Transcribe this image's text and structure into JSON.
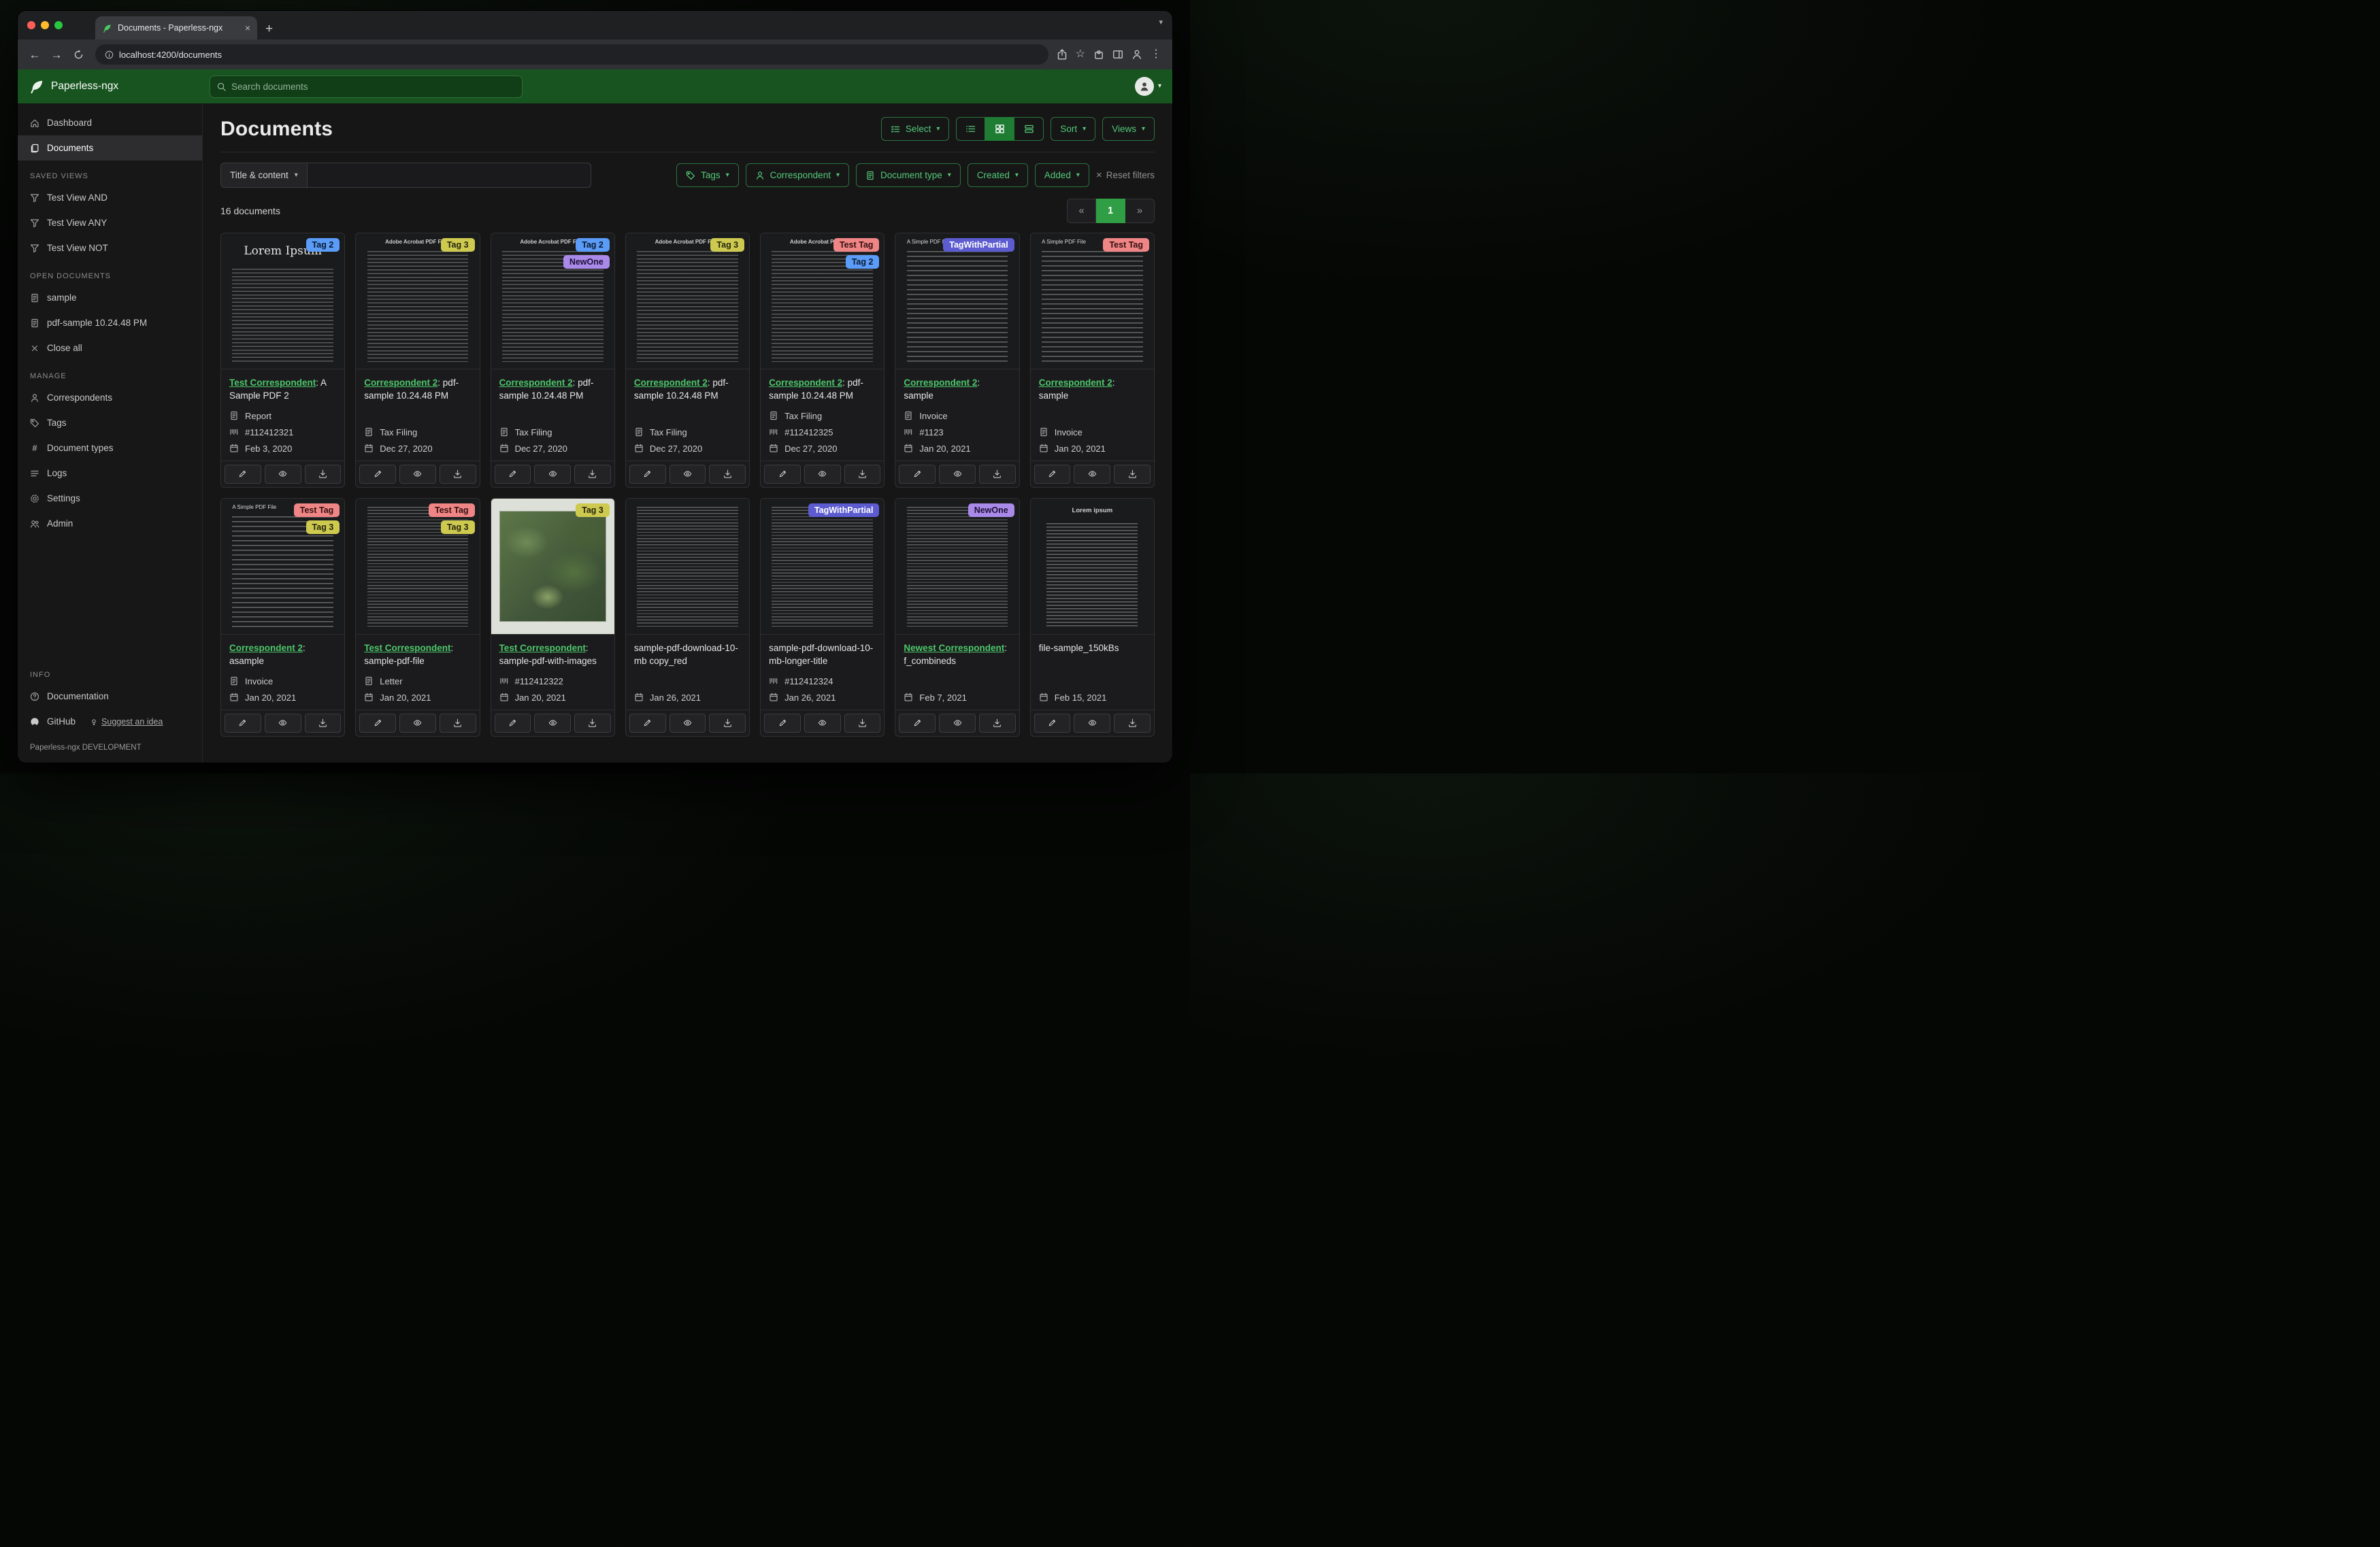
{
  "browser": {
    "tab_title": "Documents - Paperless-ngx",
    "url": "localhost:4200/documents"
  },
  "app_header": {
    "brand": "Paperless-ngx",
    "search_placeholder": "Search documents"
  },
  "sidebar": {
    "dashboard": "Dashboard",
    "documents": "Documents",
    "saved_views_title": "SAVED VIEWS",
    "saved_views": [
      "Test View AND",
      "Test View ANY",
      "Test View NOT"
    ],
    "open_documents_title": "OPEN DOCUMENTS",
    "open_documents": [
      "sample",
      "pdf-sample 10.24.48 PM"
    ],
    "close_all": "Close all",
    "manage_title": "MANAGE",
    "manage": [
      "Correspondents",
      "Tags",
      "Document types",
      "Logs",
      "Settings",
      "Admin"
    ],
    "info_title": "INFO",
    "documentation": "Documentation",
    "github": "GitHub",
    "suggest": "Suggest an idea",
    "footer": "Paperless-ngx DEVELOPMENT"
  },
  "main": {
    "title": "Documents",
    "select": "Select",
    "sort": "Sort",
    "views": "Views",
    "filters": {
      "mode": "Title & content",
      "tags": "Tags",
      "correspondent": "Correspondent",
      "document_type": "Document type",
      "created": "Created",
      "added": "Added",
      "reset": "Reset filters"
    },
    "count": "16 documents",
    "pagination": {
      "prev": "«",
      "page": "1",
      "next": "»"
    }
  },
  "icons": {
    "caret": "▾",
    "close": "×",
    "plus": "+",
    "kebab": "⋮",
    "star": "☆",
    "back": "←",
    "forward": "→",
    "hash": "#"
  },
  "colors": {
    "header_green": "#17541f",
    "accent_green": "#53c878",
    "link_green": "#4cc76a",
    "pagination_active": "#2f9e44",
    "tag_tag2": "#5a9cf8",
    "tag_tag3": "#cdca4f",
    "tag_newone": "#a98ae8",
    "tag_testtag": "#ef8585",
    "tag_partial": "#5c5cd0"
  },
  "documents": [
    {
      "thumb": "lorem",
      "thumb_heading": "Lorem Ipsum",
      "tags": [
        {
          "label": "Tag 2",
          "bg": "#5a9cf8",
          "fg": "#0c1a2e"
        }
      ],
      "correspondent": "Test Correspondent",
      "title_suffix": ": A Sample PDF 2",
      "doc_type": "Report",
      "asn": "#112412321",
      "date": "Feb 3, 2020"
    },
    {
      "thumb": "acrobat",
      "thumb_heading": "Adobe Acrobat PDF Files",
      "tags": [
        {
          "label": "Tag 3",
          "bg": "#cdca4f",
          "fg": "#26250e"
        }
      ],
      "correspondent": "Correspondent 2",
      "title_suffix": ": pdf-sample 10.24.48 PM",
      "doc_type": "Tax Filing",
      "date": "Dec 27, 2020"
    },
    {
      "thumb": "acrobat",
      "thumb_heading": "Adobe Acrobat PDF Files",
      "tags": [
        {
          "label": "Tag 2",
          "bg": "#5a9cf8",
          "fg": "#0c1a2e"
        },
        {
          "label": "NewOne",
          "bg": "#a98ae8",
          "fg": "#1f1038"
        }
      ],
      "correspondent": "Correspondent 2",
      "title_suffix": ": pdf-sample 10.24.48 PM",
      "doc_type": "Tax Filing",
      "date": "Dec 27, 2020"
    },
    {
      "thumb": "acrobat",
      "thumb_heading": "Adobe Acrobat PDF Files",
      "tags": [
        {
          "label": "Tag 3",
          "bg": "#cdca4f",
          "fg": "#26250e"
        }
      ],
      "correspondent": "Correspondent 2",
      "title_suffix": ": pdf-sample 10.24.48 PM",
      "doc_type": "Tax Filing",
      "date": "Dec 27, 2020"
    },
    {
      "thumb": "acrobat",
      "thumb_heading": "Adobe Acrobat PDF Files",
      "tags": [
        {
          "label": "Test Tag",
          "bg": "#ef8585",
          "fg": "#330f0f"
        },
        {
          "label": "Tag 2",
          "bg": "#5a9cf8",
          "fg": "#0c1a2e"
        }
      ],
      "correspondent": "Correspondent 2",
      "title_suffix": ": pdf-sample 10.24.48 PM",
      "doc_type": "Tax Filing",
      "asn": "#112412325",
      "date": "Dec 27, 2020"
    },
    {
      "thumb": "simple",
      "thumb_heading": "A Simple PDF File",
      "tags": [
        {
          "label": "TagWithPartial",
          "bg": "#5c5cd0",
          "fg": "#ffffff"
        }
      ],
      "correspondent": "Correspondent 2",
      "title_suffix": ": sample",
      "doc_type": "Invoice",
      "asn": "#1123",
      "date": "Jan 20, 2021"
    },
    {
      "thumb": "simple",
      "thumb_heading": "A Simple PDF File",
      "tags": [
        {
          "label": "Test Tag",
          "bg": "#ef8585",
          "fg": "#330f0f"
        }
      ],
      "correspondent": "Correspondent 2",
      "title_suffix": ": sample",
      "doc_type": "Invoice",
      "date": "Jan 20, 2021"
    },
    {
      "thumb": "simple",
      "thumb_heading": "A Simple PDF File",
      "tags": [
        {
          "label": "Test Tag",
          "bg": "#ef8585",
          "fg": "#330f0f"
        },
        {
          "label": "Tag 3",
          "bg": "#cdca4f",
          "fg": "#26250e"
        }
      ],
      "correspondent": "Correspondent 2",
      "title_suffix": ": asample",
      "doc_type": "Invoice",
      "date": "Jan 20, 2021"
    },
    {
      "thumb": "plain",
      "thumb_heading": "",
      "tags": [
        {
          "label": "Test Tag",
          "bg": "#ef8585",
          "fg": "#330f0f"
        },
        {
          "label": "Tag 3",
          "bg": "#cdca4f",
          "fg": "#26250e"
        }
      ],
      "correspondent": "Test Correspondent",
      "title_suffix": ": sample-pdf-file",
      "doc_type": "Letter",
      "date": "Jan 20, 2021"
    },
    {
      "thumb": "map",
      "thumb_heading": "",
      "tags": [
        {
          "label": "Tag 3",
          "bg": "#cdca4f",
          "fg": "#26250e"
        }
      ],
      "correspondent": "Test Correspondent",
      "title_suffix": ": sample-pdf-with-images",
      "asn": "#112412322",
      "date": "Jan 20, 2021"
    },
    {
      "thumb": "plain",
      "thumb_heading": "",
      "tags": [],
      "title": "sample-pdf-download-10-mb copy_red",
      "date": "Jan 26, 2021"
    },
    {
      "thumb": "plain",
      "thumb_heading": "",
      "tags": [
        {
          "label": "TagWithPartial",
          "bg": "#5c5cd0",
          "fg": "#ffffff"
        }
      ],
      "title": "sample-pdf-download-10-mb-longer-title",
      "asn": "#112412324",
      "date": "Jan 26, 2021"
    },
    {
      "thumb": "plain",
      "thumb_heading": "",
      "tags": [
        {
          "label": "NewOne",
          "bg": "#a98ae8",
          "fg": "#1f1038"
        }
      ],
      "correspondent": "Newest Correspondent",
      "title_suffix": ": f_combineds",
      "date": "Feb 7, 2021"
    },
    {
      "thumb": "lorem2",
      "thumb_heading": "Lorem ipsum",
      "tags": [],
      "title": "file-sample_150kBs",
      "date": "Feb 15, 2021"
    }
  ]
}
